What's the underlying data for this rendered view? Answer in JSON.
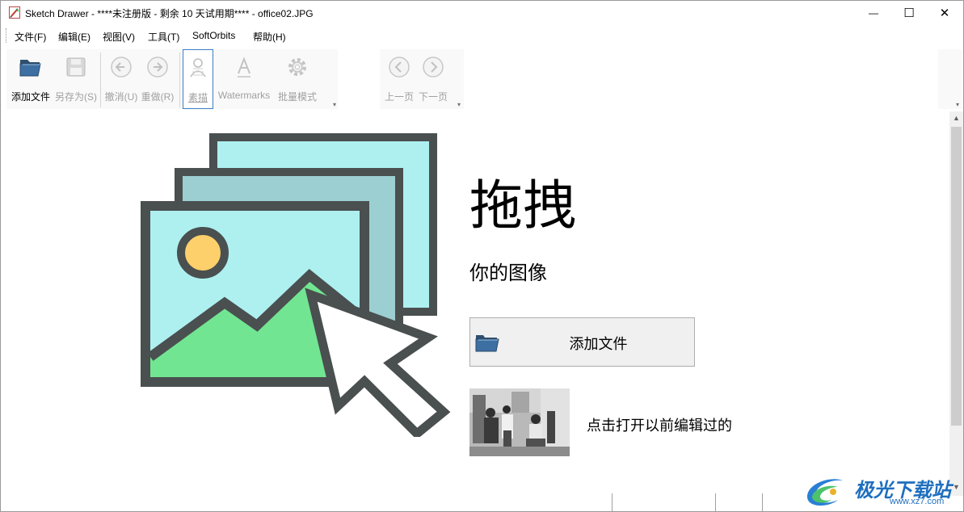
{
  "window": {
    "title": "Sketch Drawer - ****未注册版 - 剩余 10 天试用期**** - office02.JPG",
    "controls": {
      "minimize": "—",
      "maximize": "☐",
      "close": "✕"
    }
  },
  "menu": {
    "items": [
      {
        "label": "文件(F)"
      },
      {
        "label": "编辑(E)"
      },
      {
        "label": "视图(V)"
      },
      {
        "label": "工具(T)"
      },
      {
        "label": "SoftOrbits"
      },
      {
        "label": "帮助(H)"
      }
    ]
  },
  "toolbar": {
    "add_file": "添加文件",
    "save_as": "另存为(S)",
    "undo": "撤消(U)",
    "redo": "重做(R)",
    "sketch": "素描",
    "watermarks": "Watermarks",
    "batch": "批量模式",
    "prev_page": "上一页",
    "next_page": "下一页"
  },
  "main": {
    "drag_title": "拖拽",
    "drag_subtitle": "你的图像",
    "add_file_button": "添加文件",
    "recent_label": "点击打开以前编辑过的"
  },
  "watermark": {
    "text": "极光下载站",
    "url": "www.xz7.com"
  },
  "colors": {
    "illustration_dark": "#4a4f50",
    "illustration_sky": "#aef0f0",
    "illustration_sky_back": "#9ccfd1",
    "illustration_sun": "#fdd06b",
    "illustration_hill": "#72e592",
    "active_border": "#3a7dc4",
    "folder_blue": "#3d6fa3"
  }
}
